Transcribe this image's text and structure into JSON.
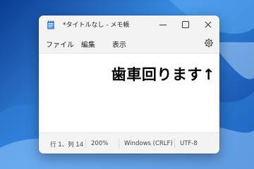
{
  "window": {
    "title": "*タイトルなし - メモ帳",
    "icons": {
      "app": "notepad-icon",
      "minimize": "minimize-icon",
      "maximize": "maximize-icon",
      "close": "close-icon",
      "settings": "gear-icon"
    }
  },
  "menu": {
    "file": "ファイル",
    "edit": "編集",
    "view": "表示"
  },
  "editor": {
    "text": "歯車回ります↑"
  },
  "status": {
    "position": "行 1、列 14",
    "zoom": "200%",
    "line_ending": "Windows (CRLF)",
    "encoding": "UTF-8"
  },
  "colors": {
    "accent": "#0b3d91",
    "chrome": "#f3f3f3"
  }
}
